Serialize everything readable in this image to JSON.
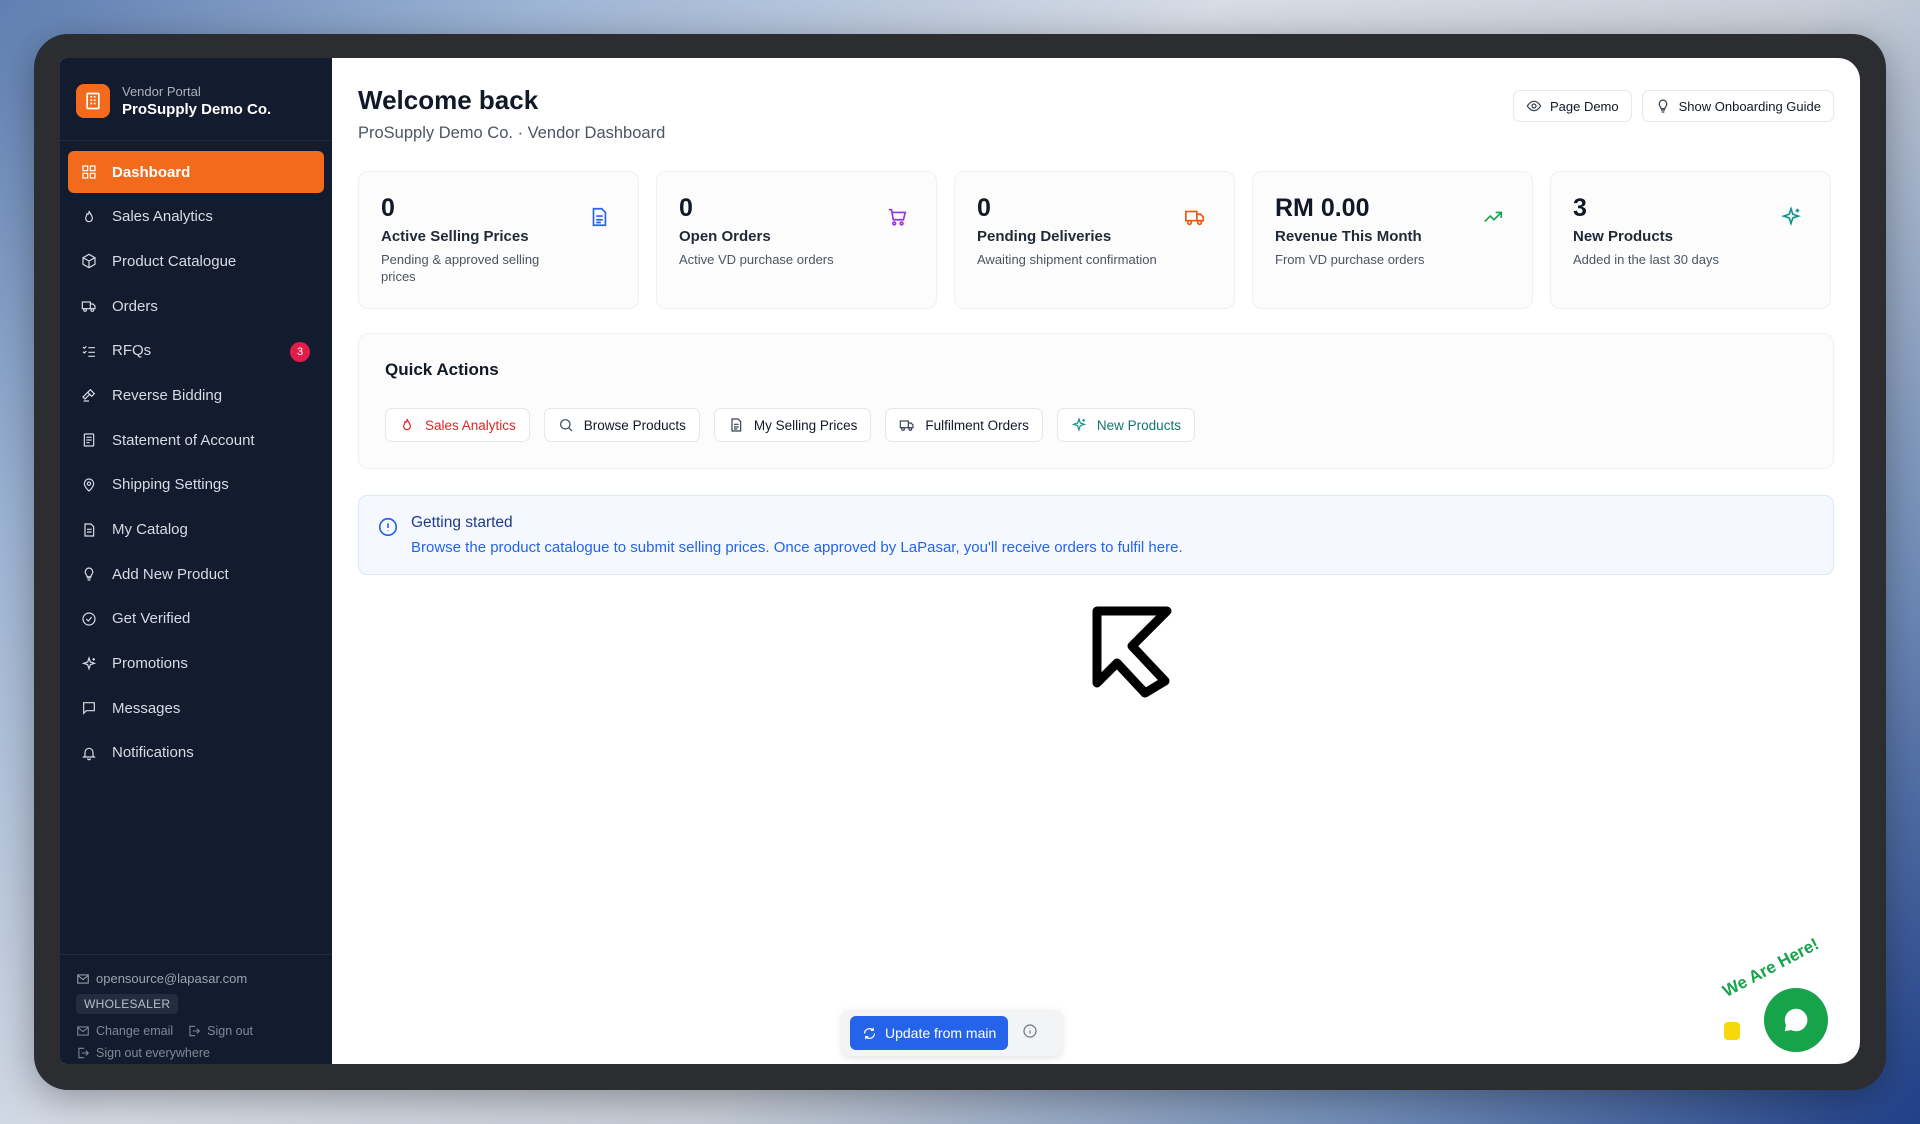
{
  "brand": {
    "portal": "Vendor Portal",
    "company": "ProSupply Demo Co."
  },
  "sidebar": {
    "items": [
      {
        "label": "Dashboard",
        "icon": "dashboard-icon",
        "active": true
      },
      {
        "label": "Sales Analytics",
        "icon": "flame-icon"
      },
      {
        "label": "Product Catalogue",
        "icon": "box-icon"
      },
      {
        "label": "Orders",
        "icon": "truck-icon"
      },
      {
        "label": "RFQs",
        "icon": "list-icon",
        "badge": "3"
      },
      {
        "label": "Reverse Bidding",
        "icon": "gavel-icon"
      },
      {
        "label": "Statement of Account",
        "icon": "document-icon"
      },
      {
        "label": "Shipping Settings",
        "icon": "map-pin-icon"
      },
      {
        "label": "My Catalog",
        "icon": "file-icon"
      },
      {
        "label": "Add New Product",
        "icon": "lightbulb-icon"
      },
      {
        "label": "Get Verified",
        "icon": "check-circle-icon"
      },
      {
        "label": "Promotions",
        "icon": "sparkles-icon"
      },
      {
        "label": "Messages",
        "icon": "message-icon"
      },
      {
        "label": "Notifications",
        "icon": "bell-icon"
      }
    ]
  },
  "footer": {
    "email": "opensource@lapasar.com",
    "role": "WHOLESALER",
    "change_email": "Change email",
    "sign_out": "Sign out",
    "sign_out_everywhere": "Sign out everywhere"
  },
  "header": {
    "title": "Welcome back",
    "subtitle": "ProSupply Demo Co. · Vendor Dashboard",
    "page_demo": "Page Demo",
    "onboarding": "Show Onboarding Guide"
  },
  "cards": [
    {
      "value": "0",
      "label": "Active Selling Prices",
      "desc": "Pending & approved selling prices",
      "icon": "document-icon",
      "color": "#2563eb"
    },
    {
      "value": "0",
      "label": "Open Orders",
      "desc": "Active VD purchase orders",
      "icon": "cart-icon",
      "color": "#9333ea"
    },
    {
      "value": "0",
      "label": "Pending Deliveries",
      "desc": "Awaiting shipment confirmation",
      "icon": "truck-icon",
      "color": "#ea580c"
    },
    {
      "value": "RM 0.00",
      "label": "Revenue This Month",
      "desc": "From VD purchase orders",
      "icon": "trend-up-icon",
      "color": "#16a34a"
    },
    {
      "value": "3",
      "label": "New Products",
      "desc": "Added in the last 30 days",
      "icon": "sparkles-icon",
      "color": "#0d9488"
    }
  ],
  "quick_actions": {
    "title": "Quick Actions",
    "buttons": [
      {
        "label": "Sales Analytics",
        "icon": "flame-icon"
      },
      {
        "label": "Browse Products",
        "icon": "search-icon"
      },
      {
        "label": "My Selling Prices",
        "icon": "document-icon"
      },
      {
        "label": "Fulfilment Orders",
        "icon": "truck-icon"
      },
      {
        "label": "New Products",
        "icon": "sparkles-icon"
      }
    ]
  },
  "info": {
    "title": "Getting started",
    "text": "Browse the product catalogue to submit selling prices. Once approved by LaPasar, you'll receive orders to fulfil here."
  },
  "update": {
    "label": "Update from main"
  },
  "chat": {
    "label": "We Are Here!"
  }
}
